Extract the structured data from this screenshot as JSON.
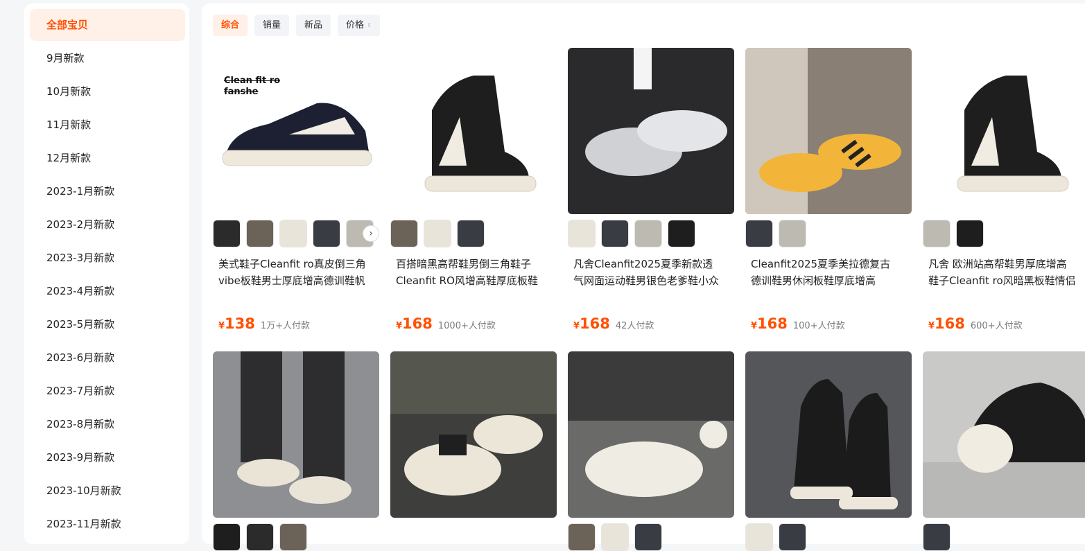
{
  "sidebar": {
    "categories": [
      {
        "label": "全部宝贝",
        "active": true
      },
      {
        "label": "9月新款"
      },
      {
        "label": "10月新款"
      },
      {
        "label": "11月新款"
      },
      {
        "label": "12月新款"
      },
      {
        "label": "2023-1月新款"
      },
      {
        "label": "2023-2月新款"
      },
      {
        "label": "2023-3月新款"
      },
      {
        "label": "2023-4月新款"
      },
      {
        "label": "2023-5月新款"
      },
      {
        "label": "2023-6月新款"
      },
      {
        "label": "2023-7月新款"
      },
      {
        "label": "2023-8月新款"
      },
      {
        "label": "2023-9月新款"
      },
      {
        "label": "2023-10月新款"
      },
      {
        "label": "2023-11月新款"
      }
    ]
  },
  "sort_tabs": [
    {
      "label": "综合",
      "active": true
    },
    {
      "label": "销量"
    },
    {
      "label": "新品"
    },
    {
      "label": "价格"
    }
  ],
  "products": [
    {
      "title": "美式鞋子Cleanfit ro真皮倒三角\nvibe板鞋男士厚底增高德训鞋帆",
      "currency": "¥",
      "price": "138",
      "sales": "1万+人付款",
      "image_text": "Clean fit ro\nfanshe",
      "icon": "low-top-sneaker-black-cream"
    },
    {
      "title": "百搭暗黑高帮鞋男倒三角鞋子\nCleanfit RO风增高鞋厚底板鞋",
      "currency": "¥",
      "price": "168",
      "sales": "1000+人付款",
      "icon": "high-top-sneaker-black-cream"
    },
    {
      "title": "凡舍Cleanfit2025夏季新款透\n气网面运动鞋男银色老爹鞋小众",
      "currency": "¥",
      "price": "168",
      "sales": "42人付款",
      "icon": "silver-mesh-runner"
    },
    {
      "title": "Cleanfit2025夏季美拉德复古\n德训鞋男休闲板鞋厚底增高",
      "currency": "¥",
      "price": "168",
      "sales": "100+人付款",
      "icon": "yellow-stripe-sneaker"
    },
    {
      "title": "凡舍 欧洲站高帮鞋男厚底增高\n鞋子Cleanfit ro风暗黑板鞋情侣",
      "currency": "¥",
      "price": "168",
      "sales": "600+人付款",
      "icon": "high-top-sneaker-black-cream"
    },
    {
      "icon": "worn-low-top-sneaker"
    },
    {
      "icon": "worn-chunky-toe-sneaker"
    },
    {
      "icon": "white-chunky-sneaker"
    },
    {
      "icon": "black-high-top-sneaker"
    },
    {
      "icon": "black-low-top-sneaker"
    }
  ],
  "colors": {
    "accent": "#ff5000",
    "active_bg": "#fff0e8"
  }
}
